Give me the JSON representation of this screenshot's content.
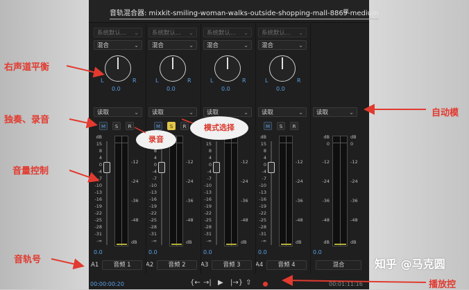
{
  "window": {
    "title": "音轨混合器: mixkit-smiling-woman-walks-outside-shopping-mall-8869-medium",
    "menu_icon": "≡"
  },
  "tracks": [
    {
      "input": "系统默认...",
      "output": "混合",
      "pan": "0.0",
      "pan_l": "L",
      "pan_r": "R",
      "automation": "读取",
      "m": "M",
      "s": "S",
      "r": "R",
      "volume": "0.0",
      "track_id": "A1",
      "name": "音频 1",
      "solo_active": false
    },
    {
      "input": "系统默认...",
      "output": "混合",
      "pan": "0.0",
      "pan_l": "L",
      "pan_r": "R",
      "automation": "读取",
      "m": "M",
      "s": "S",
      "r": "R",
      "volume": "0.0",
      "track_id": "A2",
      "name": "音频 2",
      "solo_active": true
    },
    {
      "input": "系统默认...",
      "output": "混合",
      "pan": "0.0",
      "pan_l": "L",
      "pan_r": "R",
      "automation": "读取",
      "m": "M",
      "s": "S",
      "r": "R",
      "volume": "0.0",
      "track_id": "A3",
      "name": "音频 3",
      "solo_active": false
    },
    {
      "input": "系统默认...",
      "output": "混合",
      "pan": "0.0",
      "pan_l": "L",
      "pan_r": "R",
      "automation": "读取",
      "m": "M",
      "s": "S",
      "r": "R",
      "volume": "0.0",
      "track_id": "A4",
      "name": "音频 4",
      "solo_active": false
    }
  ],
  "master": {
    "automation": "读取",
    "volume": "0.0",
    "name": "混合"
  },
  "fader_scale": [
    "dB",
    "15",
    "8",
    "4",
    "0",
    "-4",
    "-7",
    "-10",
    "-13",
    "-16",
    "-19",
    "-22",
    "-25",
    "-28",
    "-31",
    "-∞"
  ],
  "meter_scale": [
    "-12",
    "-24",
    "-36",
    "-48",
    "dB"
  ],
  "master_scale": [
    "dB",
    "0",
    "-12",
    "-24",
    "-36",
    "-48",
    "dB"
  ],
  "transport": {
    "timecode_in": "00:00:00:20",
    "timecode_out": "00:01:11:16",
    "buttons": [
      "{←",
      "→|",
      "▶",
      "|→}",
      "⇧"
    ]
  },
  "annotations": {
    "pan": "右声道平衡",
    "solo_rec": "独奏、录音",
    "volume": "音量控制",
    "track_no": "音轨号",
    "automation": "自动模",
    "playback": "播放控",
    "mode_select": "模式选择",
    "record": "录音"
  },
  "watermark": "知乎 @马克圆",
  "colors": {
    "accent_blue": "#5aa0e6",
    "solo_yellow": "#e2c64a",
    "annotation_red": "#e23a2f",
    "record_red": "#e23a2f"
  }
}
